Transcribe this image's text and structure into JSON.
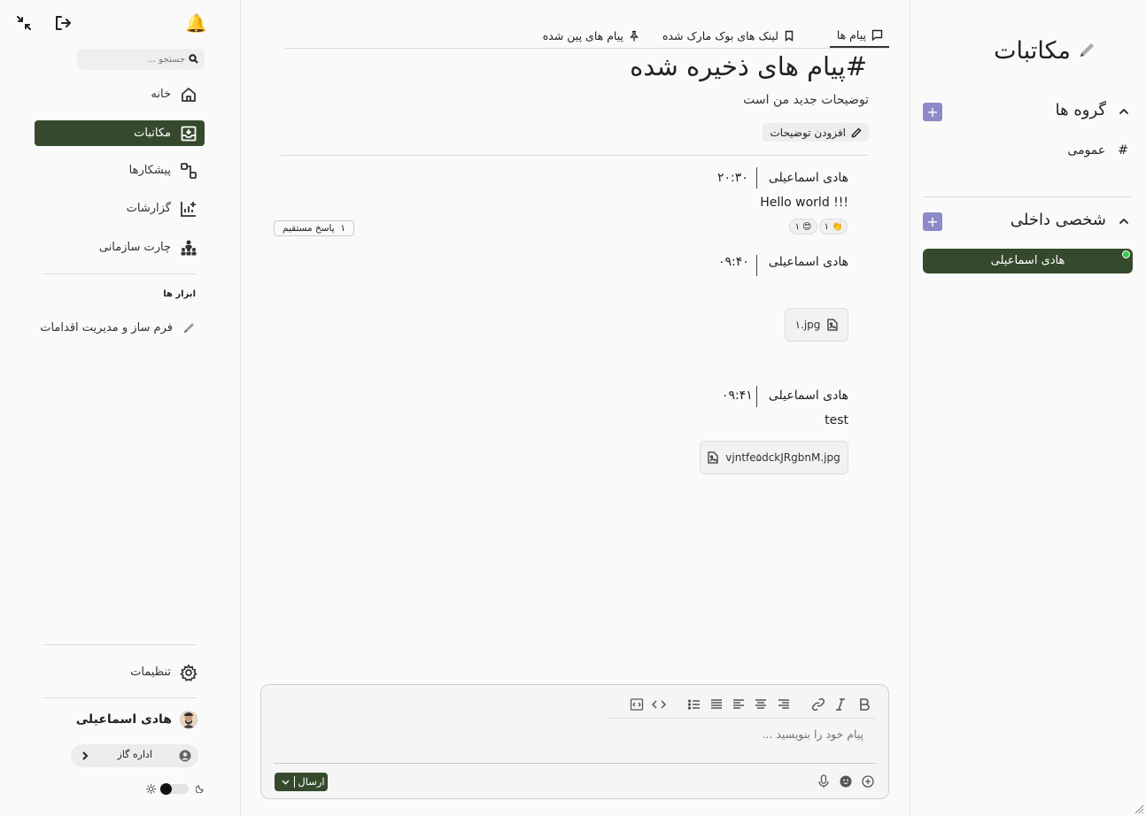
{
  "leftnav": {
    "search_placeholder": "جستجو ...",
    "items": [
      {
        "label": "خانه",
        "icon": "home-icon"
      },
      {
        "label": "مکاتبات",
        "icon": "inbox-icon",
        "active": true
      },
      {
        "label": "پیشکارها",
        "icon": "workflow-icon"
      },
      {
        "label": "گزارشات",
        "icon": "chart-icon"
      },
      {
        "label": "چارت سازمانی",
        "icon": "org-chart-icon"
      }
    ],
    "tools_heading": "ابزار ها",
    "tools": [
      {
        "label": "فرم ساز و مدیریت اقدامات",
        "icon": "pen-icon"
      }
    ],
    "settings_label": "تنظیمات",
    "user_name": "هادی اسماعیلی",
    "org_label": "اداره گاز"
  },
  "main": {
    "tabs": [
      {
        "label": "پیام ها",
        "icon": "message-icon",
        "active": true
      },
      {
        "label": "لینک های بوک مارک شده",
        "icon": "bookmark-icon"
      },
      {
        "label": "پیام های پین شده",
        "icon": "pin-icon"
      }
    ],
    "channel_title": "#پیام های ذخیره شده",
    "channel_description": "توضیحات جدید من است",
    "add_description_label": "افزودن توضیحات",
    "messages": [
      {
        "author": "هادی اسماعیلی",
        "time": "۲۰:۳۰",
        "text": "Hello world !!!",
        "reactions": [
          {
            "emoji": "👏",
            "count": "۱"
          },
          {
            "emoji": "😍",
            "count": "۱"
          }
        ],
        "thread_label": "۱  پاسخ مستقیم"
      },
      {
        "author": "هادی اسماعیلی",
        "time": "۰۹:۴۰",
        "file": "۱.jpg"
      },
      {
        "author": "هادی اسماعیلی",
        "time": "۰۹:۴۱",
        "text": "test",
        "file": "vjntfe۵dckJRgbnM.jpg"
      }
    ],
    "composer": {
      "placeholder": "پیام خود را بنویسید ...",
      "send_label": "ارسال"
    }
  },
  "rightpanel": {
    "title": "مکاتبات",
    "groups_title": "گروه ها",
    "groups": [
      {
        "label": "عمومی"
      }
    ],
    "direct_title": "شخصی داخلی",
    "direct": [
      {
        "label": "هادی اسماعیلی"
      }
    ]
  },
  "colors": {
    "accent": "#354a2c",
    "plus": "#8c8bc7",
    "online": "#2ecc40"
  }
}
